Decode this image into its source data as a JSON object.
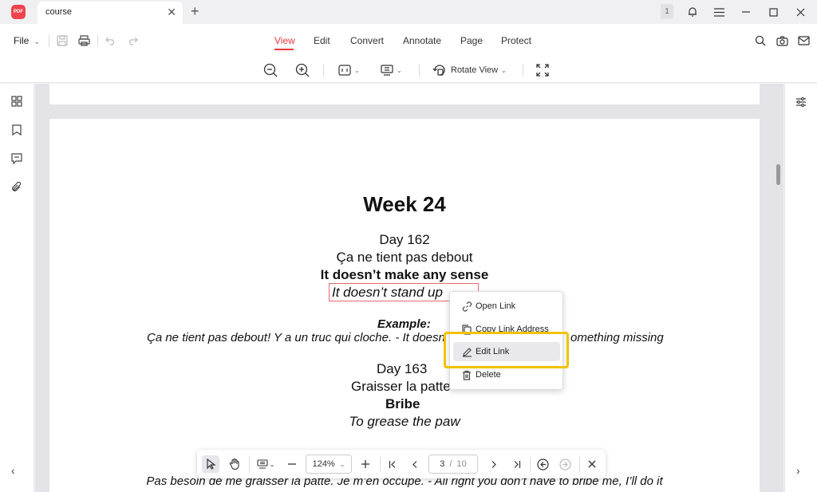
{
  "titlebar": {
    "app_logo_text": "PDF",
    "tab_title": "course",
    "tab_close": "✕",
    "new_tab": "+",
    "notification_count": "1"
  },
  "menubar": {
    "file_label": "File",
    "tabs": [
      "View",
      "Edit",
      "Convert",
      "Annotate",
      "Page",
      "Protect"
    ],
    "active_tab": "View"
  },
  "viewbar": {
    "rotate_view_label": "Rotate View"
  },
  "document": {
    "heading": "Week 24",
    "day1_label": "Day 162",
    "day1_french": "Ça ne tient pas debout",
    "day1_meaning": "It doesn’t make any sense",
    "day1_literal_visible": "It doesn’t stand up",
    "example_label": "Example:",
    "example_line_left": "Ça ne tient pas debout! Y a un truc qui cloche. - It doesn",
    "example_line_right": "omething missing",
    "day2_label": "Day 163",
    "day2_french_visible": "Graisser la patte",
    "day2_meaning": "Bribe",
    "day2_literal": "To grease the paw",
    "bottom_line": "Pas besoin de me graisser la patte. Je m’en occupe. - All right you don’t have to bribe me, I’ll do it"
  },
  "context_menu": {
    "items": [
      "Open Link",
      "Copy Link Address",
      "Edit Link",
      "Delete"
    ],
    "hovered": "Edit Link"
  },
  "bottombar": {
    "zoom_level": "124%",
    "current_page": "3",
    "page_separator": "/",
    "total_pages": "10"
  },
  "colors": {
    "accent": "#e8363d",
    "highlight": "#f2c200",
    "link_border": "#e86a6a"
  }
}
